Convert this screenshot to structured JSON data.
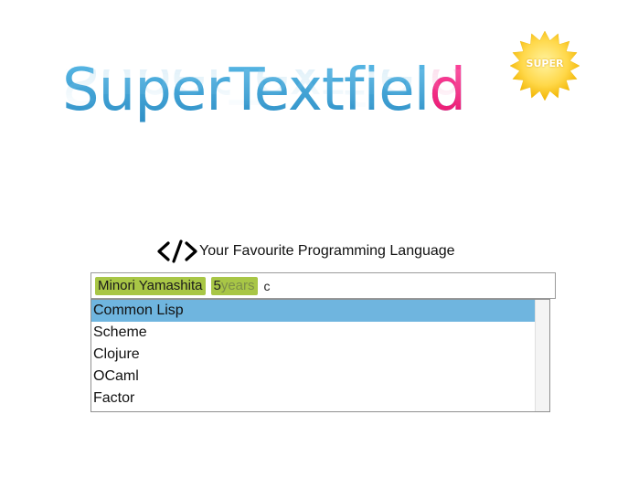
{
  "logo": {
    "text_main": "SuperTextfiel",
    "text_accent": "d",
    "badge": "SUPER"
  },
  "field": {
    "label": "Your Favourite Programming Language",
    "icon": "code-icon"
  },
  "input": {
    "tokens": {
      "name": "Minori Yamashita",
      "years_value": "5",
      "years_unit": "years"
    },
    "typed_value": "c"
  },
  "dropdown": {
    "selected_index": 0,
    "items": [
      "Common Lisp",
      "Scheme",
      "Clojure",
      "OCaml",
      "Factor"
    ]
  },
  "colors": {
    "logo_blue": "#3a9fd6",
    "logo_pink": "#ff2a8a",
    "token_green": "#a8c646",
    "selection_blue": "#6fb5df",
    "badge_yellow": "#ffd84a"
  }
}
